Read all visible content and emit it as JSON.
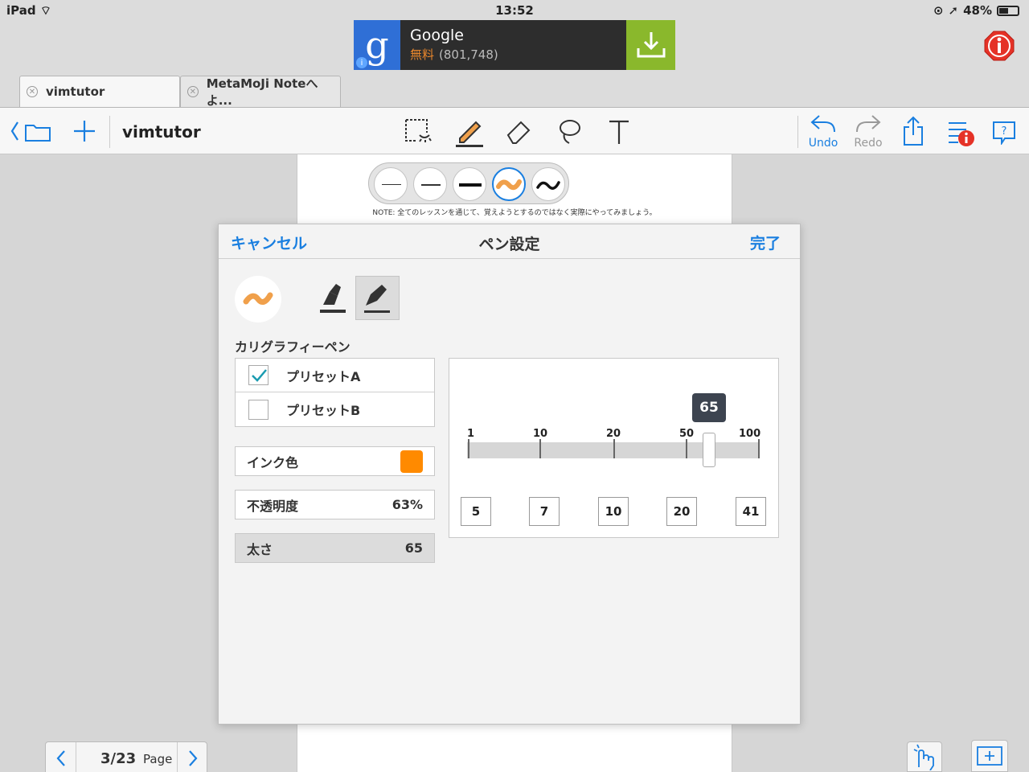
{
  "status_bar": {
    "device": "iPad",
    "time": "13:52",
    "battery": "48%"
  },
  "ad": {
    "logo_letter": "g",
    "title": "Google",
    "free_label": "無料",
    "rating_count": "(801,748)"
  },
  "tabs": [
    {
      "label": "vimtutor"
    },
    {
      "label": "MetaMoJi Noteへよ..."
    }
  ],
  "toolbar": {
    "doc_title": "vimtutor",
    "undo_label": "Undo",
    "redo_label": "Redo"
  },
  "note_text": "NOTE: 全てのレッスンを通じて、覚えようとするのではなく実際にやってみましょう。",
  "dialog": {
    "cancel_label": "キャンセル",
    "title": "ペン設定",
    "done_label": "完了",
    "pen_type": "カリグラフィーペン",
    "presets": [
      {
        "label": "プリセットA",
        "checked": true
      },
      {
        "label": "プリセットB",
        "checked": false
      }
    ],
    "ink_color": {
      "label": "インク色",
      "color": "#ff8a00"
    },
    "opacity": {
      "label": "不透明度",
      "value": "63%"
    },
    "thickness": {
      "label": "太さ",
      "value": "65"
    },
    "slider": {
      "value": "65",
      "ticks": [
        "1",
        "10",
        "20",
        "50",
        "100"
      ],
      "quick_values": [
        "5",
        "7",
        "10",
        "20",
        "41"
      ]
    }
  },
  "pager": {
    "current": "3/23",
    "label": "Page"
  },
  "colors": {
    "accent": "#1a7fe0",
    "pen_orange": "#f0a04b",
    "ink": "#ff8a00"
  }
}
